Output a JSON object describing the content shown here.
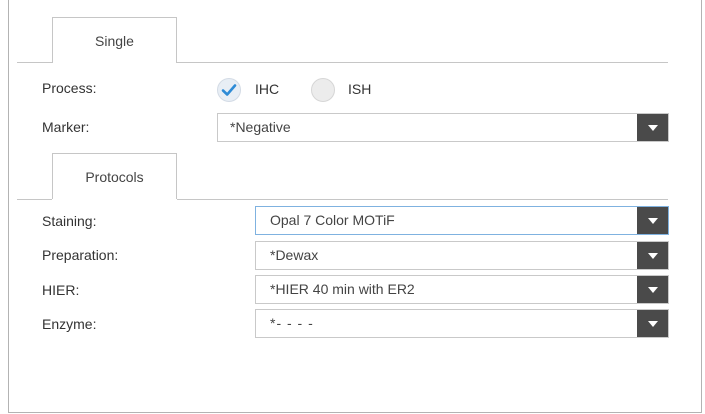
{
  "tabs": {
    "single": "Single",
    "protocols": "Protocols"
  },
  "process": {
    "label": "Process:",
    "options": [
      {
        "label": "IHC",
        "checked": true
      },
      {
        "label": "ISH",
        "checked": false
      }
    ]
  },
  "marker": {
    "label": "Marker:",
    "value": "*Negative"
  },
  "staining": {
    "label": "Staining:",
    "value": "Opal 7 Color MOTiF"
  },
  "preparation": {
    "label": "Preparation:",
    "value": "*Dewax"
  },
  "hier": {
    "label": "HIER:",
    "value": "*HIER 40 min with ER2"
  },
  "enzyme": {
    "label": "Enzyme:",
    "value": "*- - - -"
  },
  "colors": {
    "accent": "#2e8bd6",
    "dropdown_button": "#4a4a4a",
    "border": "#c9c9c9"
  },
  "icons": {
    "check": "checkmark-icon",
    "dropdown": "chevron-down-icon"
  }
}
